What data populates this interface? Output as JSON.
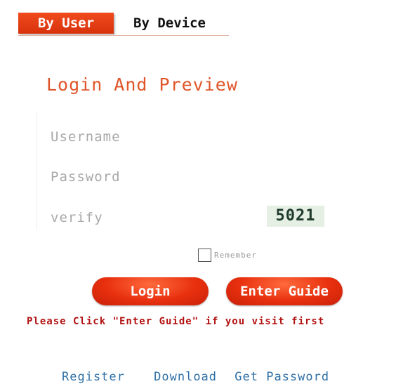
{
  "tabs": {
    "by_user": "By User",
    "by_device": "By Device"
  },
  "form": {
    "title": "Login And Preview",
    "username_label": "Username",
    "password_label": "Password",
    "verify_label": "verify",
    "captcha_value": "5021",
    "remember_label": "Remember",
    "login_button": "Login",
    "guide_button": "Enter Guide"
  },
  "notice": "Please Click \"Enter Guide\" if you visit first",
  "links": {
    "register": "Register",
    "download": "Download",
    "get_password": "Get Password"
  },
  "colors": {
    "accent": "#e8300e",
    "title": "#e0552a",
    "notice": "#b31212",
    "link": "#2f6fa6"
  }
}
